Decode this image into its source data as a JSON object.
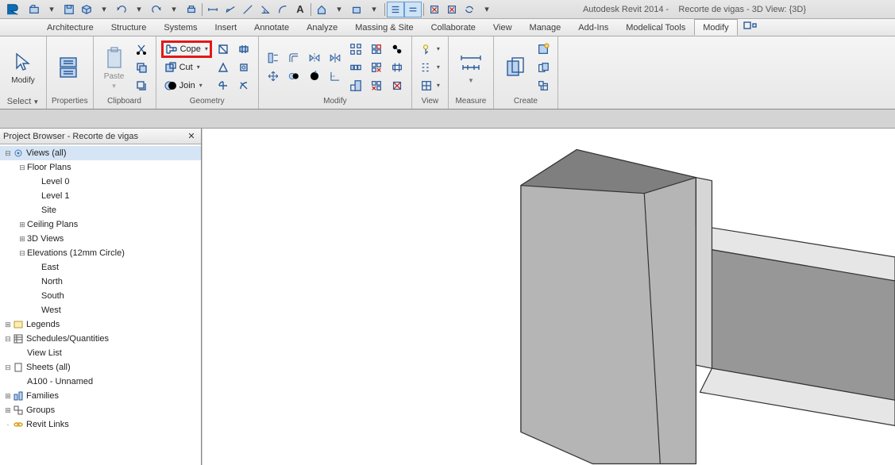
{
  "app": {
    "name": "Autodesk Revit 2014",
    "doc": "Recorte de vigas",
    "view": "3D View: {3D}"
  },
  "qat_icons": [
    "open",
    "save",
    "cube",
    "undo",
    "redo",
    "undo2",
    "print",
    "measure",
    "dim",
    "line",
    "angle",
    "text",
    "house",
    "box",
    "link",
    "align",
    "eq",
    "rx",
    "close",
    "sync"
  ],
  "tabs": [
    "Architecture",
    "Structure",
    "Systems",
    "Insert",
    "Annotate",
    "Analyze",
    "Massing & Site",
    "Collaborate",
    "View",
    "Manage",
    "Add-Ins",
    "Modelical Tools",
    "Modify"
  ],
  "active_tab": "Modify",
  "panels": {
    "select": {
      "title": "Select",
      "button": "Modify"
    },
    "properties": {
      "title": "Properties"
    },
    "clipboard": {
      "title": "Clipboard",
      "paste": "Paste"
    },
    "geometry": {
      "title": "Geometry",
      "cope": "Cope",
      "cut": "Cut",
      "join": "Join"
    },
    "modify": {
      "title": "Modify"
    },
    "view": {
      "title": "View"
    },
    "measure": {
      "title": "Measure"
    },
    "create": {
      "title": "Create"
    }
  },
  "browser": {
    "title": "Project Browser - Recorte de vigas",
    "tree": [
      {
        "d": 0,
        "expand": "-",
        "icon": "views",
        "label": "Views (all)",
        "sel": true
      },
      {
        "d": 1,
        "expand": "-",
        "icon": "",
        "label": "Floor Plans"
      },
      {
        "d": 2,
        "expand": ".",
        "icon": "",
        "label": "Level 0"
      },
      {
        "d": 2,
        "expand": ".",
        "icon": "",
        "label": "Level 1"
      },
      {
        "d": 2,
        "expand": ".",
        "icon": "",
        "label": "Site"
      },
      {
        "d": 1,
        "expand": "+",
        "icon": "",
        "label": "Ceiling Plans"
      },
      {
        "d": 1,
        "expand": "+",
        "icon": "",
        "label": "3D Views"
      },
      {
        "d": 1,
        "expand": "-",
        "icon": "",
        "label": "Elevations (12mm Circle)"
      },
      {
        "d": 2,
        "expand": ".",
        "icon": "",
        "label": "East"
      },
      {
        "d": 2,
        "expand": ".",
        "icon": "",
        "label": "North"
      },
      {
        "d": 2,
        "expand": ".",
        "icon": "",
        "label": "South"
      },
      {
        "d": 2,
        "expand": ".",
        "icon": "",
        "label": "West"
      },
      {
        "d": 0,
        "expand": "+",
        "icon": "legend",
        "label": "Legends"
      },
      {
        "d": 0,
        "expand": "-",
        "icon": "sched",
        "label": "Schedules/Quantities"
      },
      {
        "d": 1,
        "expand": ".",
        "icon": "",
        "label": "View List"
      },
      {
        "d": 0,
        "expand": "-",
        "icon": "sheet",
        "label": "Sheets (all)"
      },
      {
        "d": 1,
        "expand": ".",
        "icon": "",
        "label": "A100 - Unnamed"
      },
      {
        "d": 0,
        "expand": "+",
        "icon": "family",
        "label": "Families"
      },
      {
        "d": 0,
        "expand": "+",
        "icon": "group",
        "label": "Groups"
      },
      {
        "d": 0,
        "expand": " ",
        "icon": "link",
        "label": "Revit Links"
      }
    ]
  }
}
